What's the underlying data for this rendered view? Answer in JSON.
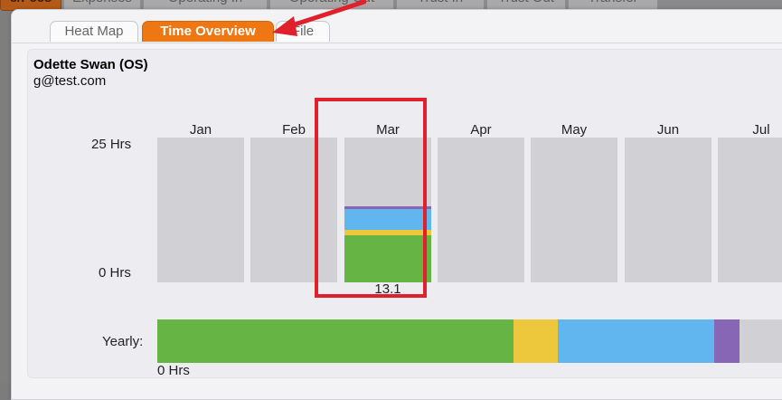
{
  "background_tabs": [
    {
      "label": "e/Fees",
      "accent": true
    },
    {
      "label": "Expenses"
    },
    {
      "label": "Operating In"
    },
    {
      "label": "Operating Out"
    },
    {
      "label": "Trust In"
    },
    {
      "label": "Trust Out"
    },
    {
      "label": "Transfer"
    }
  ],
  "tabs": [
    {
      "label": "Heat Map",
      "active": false
    },
    {
      "label": "Time Overview",
      "active": true
    },
    {
      "label": "File",
      "active": false
    }
  ],
  "person": {
    "name": "Odette Swan (OS)",
    "email": "g@test.com"
  },
  "axis": {
    "max_label": "25 Hrs",
    "min_label": "0 Hrs"
  },
  "months": [
    {
      "label": "Jan",
      "total": ""
    },
    {
      "label": "Feb",
      "total": ""
    },
    {
      "label": "Mar",
      "total": "13.1",
      "segments": [
        {
          "hours": 8.1,
          "color": "#66b444"
        },
        {
          "hours": 0.9,
          "color": "#edc83c"
        },
        {
          "hours": 3.6,
          "color": "#62b6f0"
        },
        {
          "hours": 0.5,
          "color": "#8766b6"
        }
      ]
    },
    {
      "label": "Apr",
      "total": ""
    },
    {
      "label": "May",
      "total": ""
    },
    {
      "label": "Jun",
      "total": ""
    },
    {
      "label": "Jul",
      "total": ""
    }
  ],
  "axis_max_hours": 25,
  "yearly": {
    "label": "Yearly:",
    "zero_label": "0 Hrs",
    "segments": [
      {
        "fraction": 0.547,
        "color": "#66b444"
      },
      {
        "fraction": 0.068,
        "color": "#edc83c"
      },
      {
        "fraction": 0.24,
        "color": "#62b6f0"
      },
      {
        "fraction": 0.04,
        "color": "#8766b6"
      }
    ]
  },
  "colors": {
    "accent": "#ee7713",
    "annotation": "#e0202a"
  }
}
